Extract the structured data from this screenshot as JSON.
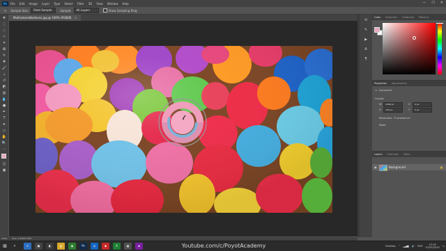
{
  "menubar": {
    "logo": "Ps",
    "items": [
      "File",
      "Edit",
      "Image",
      "Layer",
      "Type",
      "Select",
      "Filter",
      "3D",
      "View",
      "Window",
      "Help"
    ],
    "window_controls": [
      "—",
      "☐",
      "✕"
    ]
  },
  "options": {
    "sample_size_label": "Sample Size:",
    "sample_size_value": "Point Sample",
    "sample_label": "Sample:",
    "sample_value": "All Layers",
    "show_ring_label": "Show Sampling Ring"
  },
  "document": {
    "tab_title": "Multicoloredballoons.jpg @ 100% (RGB/8)",
    "close": "×",
    "status_left": "100%",
    "status_doc": "Doc: 1.97M/1.97M"
  },
  "color_panel": {
    "tabs": [
      "Color",
      "Swatches",
      "Gradients",
      "Patterns"
    ],
    "fg_color": "#e8a6c0",
    "bg_color": "#ffffff"
  },
  "properties_panel": {
    "tabs": [
      "Properties",
      "Adjustments"
    ],
    "doc_label": "Document",
    "canvas_label": "Canvas",
    "w_label": "W",
    "w_value": "1280 px",
    "h_label": "H",
    "h_value": "720 px",
    "x_label": "X",
    "x_value": "0 px",
    "y_label": "Y",
    "y_value": "0 px",
    "resolution": "Resolution: 72 pixels/inch",
    "mode_label": "Mode"
  },
  "layers_panel": {
    "tabs": [
      "Layers",
      "Channels",
      "Paths"
    ],
    "layer_name": "Background",
    "eye": "◉",
    "lock": "🔒"
  },
  "taskbar": {
    "start": "⊞",
    "search": "⌕",
    "watermark": "Youtube.com/c/PoyotAcademy",
    "desktop_label": "Desktop",
    "lang": "ENG",
    "time": "13:16",
    "date": "07/05/2020",
    "apps": [
      {
        "label": "e",
        "color": "#2b6fbf"
      },
      {
        "label": "▣",
        "color": "#444444"
      },
      {
        "label": "◧",
        "color": "#3a3a3a"
      },
      {
        "label": "▤",
        "color": "#d8a82a"
      },
      {
        "label": "◉",
        "color": "#2e7d32"
      },
      {
        "label": "Ps",
        "color": "#0f2a4a"
      },
      {
        "label": "◎",
        "color": "#1565c0"
      },
      {
        "label": "◆",
        "color": "#c62828"
      },
      {
        "label": "X",
        "color": "#1e7e34"
      },
      {
        "label": "▦",
        "color": "#505050"
      },
      {
        "label": "◈",
        "color": "#7b1fa2"
      }
    ]
  },
  "picker_ring": {
    "top_color": "#ef9fbb",
    "bottom_color": "#dd92b0",
    "ring_color": "#7fb3d8"
  }
}
